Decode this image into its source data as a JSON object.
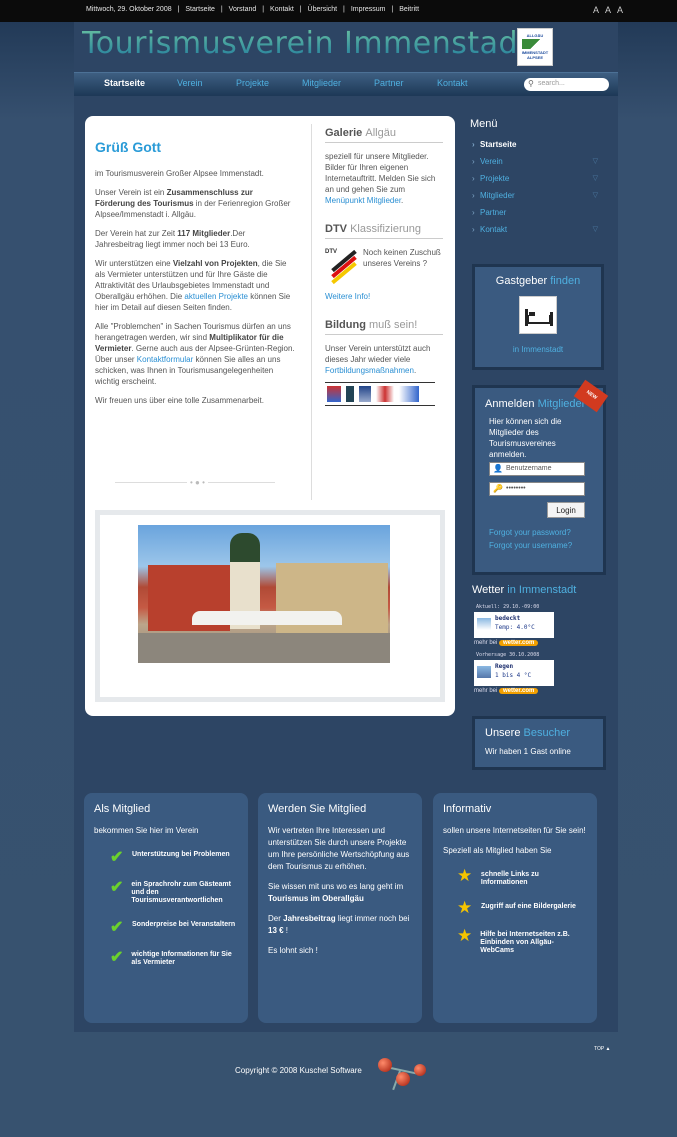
{
  "topbar": {
    "date": "Mittwoch, 29. Oktober 2008",
    "links": [
      "Startseite",
      "Vorstand",
      "Kontakt",
      "Übersicht",
      "Impressum",
      "Beitritt"
    ],
    "icons": [
      "font-small-icon",
      "font-medium-icon",
      "font-large-icon"
    ]
  },
  "header": {
    "site_title": "Tourismusverein Immenstadt",
    "logo_text_1": "ALLGÄU",
    "logo_text_2": "IMMENSTADT",
    "logo_text_3": "ALPSEE"
  },
  "nav": {
    "items": [
      "Startseite",
      "Verein",
      "Projekte",
      "Mitglieder",
      "Partner",
      "Kontakt"
    ],
    "search_placeholder": "search..."
  },
  "intro": {
    "heading": "Grüß Gott",
    "p1": "im Tourismusverein Großer Alpsee Immenstadt.",
    "p2a": "Unser Verein ist ein ",
    "p2b": "Zusammenschluss zur Förderung des Tourismus",
    "p2c": " in der Ferienregion Großer Alpsee/Immenstadt i. Allgäu.",
    "p3a": "Der Verein hat zur Zeit ",
    "p3b": "117 Mitglieder",
    "p3c": ".Der Jahresbeitrag liegt immer noch bei 13 Euro.",
    "p4a": "Wir unterstützen eine ",
    "p4b": "Vielzahl von Projekten",
    "p4c": ", die Sie als Vermieter unterstützen und für Ihre Gäste die Attraktivität des Urlaubsgebietes Immenstadt und Oberallgäu erhöhen. Die ",
    "p4d": "aktuellen Projekte",
    "p4e": " können Sie hier im Detail auf diesen Seiten finden.",
    "p5a": "Alle \"Problemchen\" in Sachen Tourismus dürfen an uns herangetragen werden, wir sind ",
    "p5b": "Multiplikator für die Vermieter",
    "p5c": ". Gerne auch aus der Alpsee-Grünten-Region.  Über unser ",
    "p5d": "Kontaktformular",
    "p5e": " können Sie alles an uns schicken, was Ihnen in Tourismusangelegenheiten wichtig erscheint.",
    "p6": "Wir freuen uns über eine tolle Zusammenarbeit."
  },
  "side": {
    "galerie_title_a": "Galerie ",
    "galerie_title_b": "Allgäu",
    "galerie_text": "speziell für unsere Mitglieder. Bilder für Ihren eigenen Internetauftritt. Melden Sie sich an und gehen Sie zum ",
    "galerie_link": "Menüpunkt Mitglieder",
    "galerie_end": ".",
    "dtv_title_a": "DTV ",
    "dtv_title_b": "Klassifizierung",
    "dtv_logo": "DTV",
    "dtv_text": "Noch keinen Zuschuß unseres Vereins ?",
    "dtv_link": "Weitere Info!",
    "bildung_title_a": "Bildung ",
    "bildung_title_b": "muß sein!",
    "bildung_text": "Unser Verein unterstützt auch dieses Jahr wieder viele ",
    "bildung_link": "Fortbildungsmaßnahmen",
    "bildung_end": "."
  },
  "menu": {
    "title": "Menü",
    "items": [
      "Startseite",
      "Verein",
      "Projekte",
      "Mitglieder",
      "Partner",
      "Kontakt"
    ]
  },
  "gastgeber": {
    "title_a": "Gastgeber ",
    "title_b": "finden",
    "link": "in Immenstadt"
  },
  "login": {
    "title_a": "Anmelden ",
    "title_b": "Mitglieder",
    "ribbon": "NEW",
    "desc": "Hier können sich die Mitglieder des Tourismusvereines anmelden.",
    "username_placeholder": "Benutzername",
    "password_value": "••••••••",
    "button": "Login",
    "forgot_password": "Forgot your password?",
    "forgot_username": "Forgot your username?"
  },
  "wetter": {
    "title_a": "Wetter ",
    "title_b": "in Immenstadt",
    "row1_header": "Aktuell: 29.10.-09:00",
    "row1_cond": "bedeckt",
    "row1_temp": "Temp: 4.0°C",
    "row2_header": "Vorhersage 30.10.2008",
    "row2_cond": "Regen",
    "row2_temp": "1 bis 4 °C",
    "more_label": "mehr bei",
    "more_brand": "wetter.com"
  },
  "besucher": {
    "title_a": "Unsere ",
    "title_b": "Besucher",
    "text": "Wir haben 1 Gast online"
  },
  "footer_cols": {
    "c1_title": "Als Mitglied",
    "c1_text": "bekommen Sie hier im Verein",
    "c1_items": [
      "Unterstützung bei Problemen",
      "ein Sprachrohr zum Gästeamt und den Tourismusverantwortlichen",
      "Sonderpreise bei Veranstaltern",
      "wichtige Informationen für Sie als Vermieter"
    ],
    "c2_title": "Werden Sie Mitglied",
    "c2_p1": "Wir vertreten Ihre Interessen und unterstützen Sie durch unsere Projekte um Ihre persönliche Wertschöpfung aus dem Tourismus zu erhöhen.",
    "c2_p2a": "Sie wissen mit uns wo es lang geht im ",
    "c2_p2b": "Tourismus im Oberallgäu",
    "c2_p3a": "Der ",
    "c2_p3b": "Jahresbeitrag",
    "c2_p3c": " liegt immer noch bei ",
    "c2_p3d": "13 €",
    "c2_p3e": " !",
    "c2_p4": "Es lohnt sich !",
    "c3_title": "Informativ",
    "c3_p1": "sollen unsere Internetseiten für Sie sein!",
    "c3_p2": "Speziell als Mitglied haben Sie",
    "c3_items": [
      "schnelle Links zu Informationen",
      "Zugriff auf eine Bildergalerie",
      "Hilfe bei Internetseiten z.B. Einbinden von Allgäu-WebCams"
    ]
  },
  "footer": {
    "top_link": "TOP ▲",
    "copyright": "Copyright © 2008 Kuschel Software"
  },
  "colors": {
    "accent": "#4fb0e0",
    "heading": "#2a9bd7",
    "background": "#2f4a6d",
    "panel": "#3a5a80"
  }
}
